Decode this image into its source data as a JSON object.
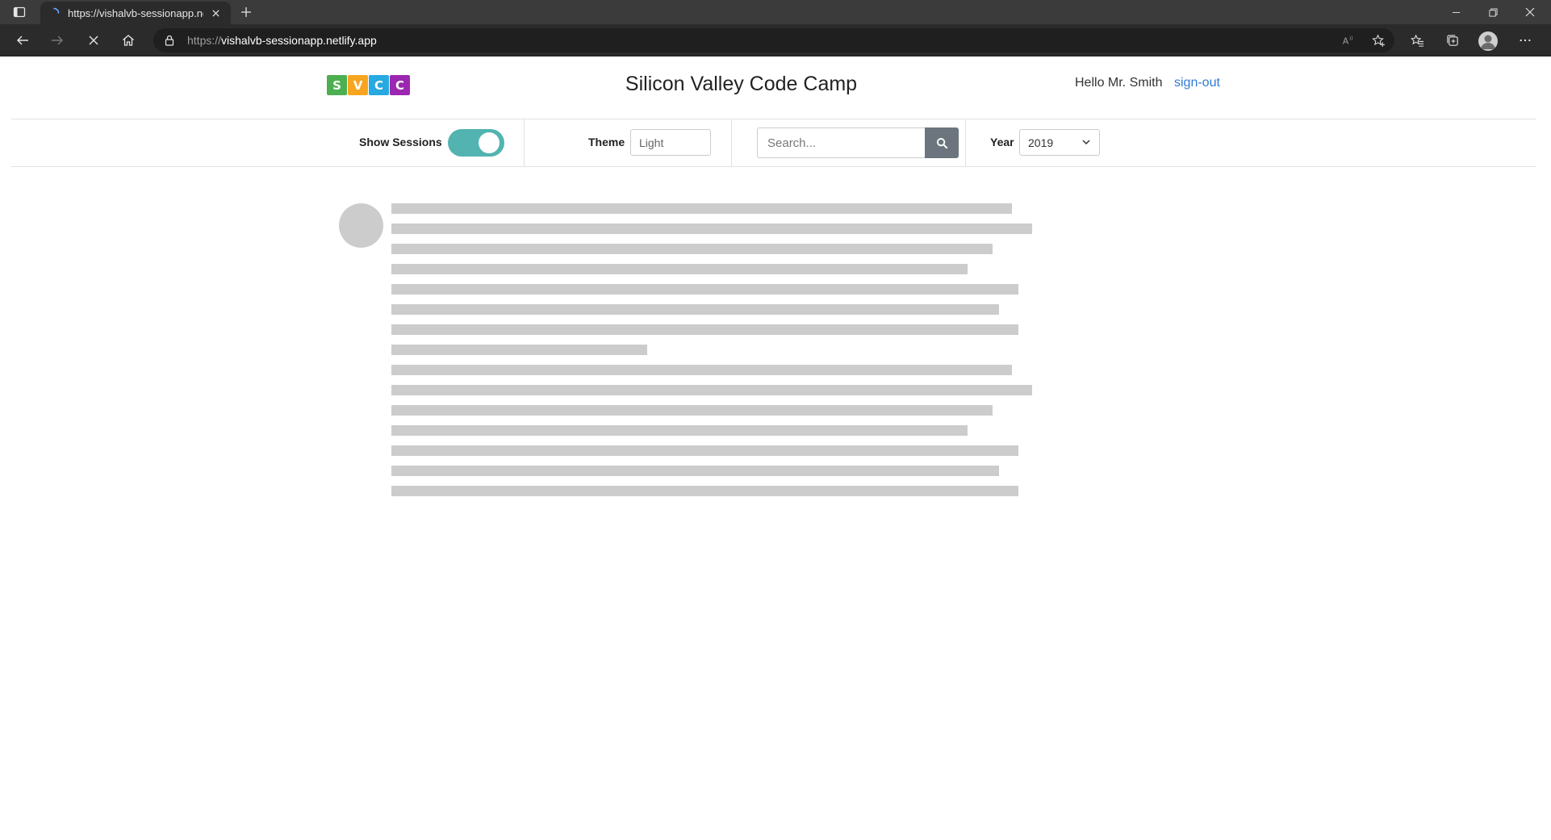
{
  "browser": {
    "tab_title": "https://vishalvb-sessionapp.netlify.app",
    "url_protocol": "https://",
    "url_host": "vishalvb-sessionapp.netlify.app"
  },
  "header": {
    "logo_letters": [
      "S",
      "V",
      "C",
      "C"
    ],
    "logo_colors": [
      "#4caf50",
      "#f7a51f",
      "#27a9e1",
      "#9c27b0"
    ],
    "title": "Silicon Valley Code Camp",
    "greeting": "Hello Mr. Smith",
    "signout_label": "sign-out"
  },
  "controls": {
    "show_sessions_label": "Show Sessions",
    "show_sessions_on": true,
    "theme_label": "Theme",
    "theme_value": "Light",
    "search_placeholder": "Search...",
    "year_label": "Year",
    "year_value": "2019"
  },
  "colors": {
    "toggle_on": "#52b3b0",
    "link": "#2f7ad6",
    "search_button": "#6c757d",
    "skeleton": "#cccccc"
  }
}
